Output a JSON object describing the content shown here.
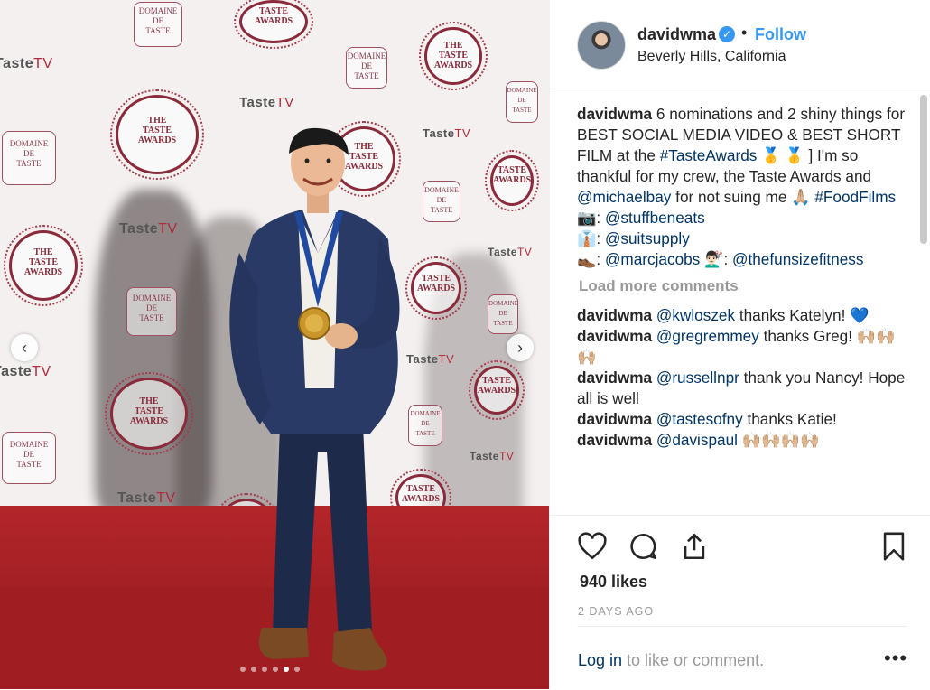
{
  "post": {
    "username": "davidwma",
    "follow_label": "Follow",
    "separator": "•",
    "location": "Beverly Hills, California",
    "verified_glyph": "✓"
  },
  "photo": {
    "backdrop_logos": {
      "domaine": [
        "DOMAINE",
        "DE",
        "TASTE"
      ],
      "taste_awards": [
        "THE",
        "TASTE",
        "AWARDS"
      ],
      "tastetv_a": "Taste",
      "tastetv_b": "TV"
    },
    "prev_glyph": "‹",
    "next_glyph": "›",
    "carousel": {
      "count": 6,
      "active_index": 4
    }
  },
  "caption": {
    "username": "davidwma",
    "text_1": " 6 nominations and 2 shiny things for BEST SOCIAL MEDIA VIDEO & BEST SHORT FILM at the ",
    "tag_taste": "#TasteAwards",
    "text_2": " 🥇 🥇 ] I'm so thankful for my crew, the Taste Awards and ",
    "mention_bay": "@michaelbay",
    "text_3": " for not suing me 🙏🏼 ",
    "tag_food": "#FoodFilms",
    "credit_1_prefix": "📷: ",
    "credit_1": "@stuffbeneats",
    "credit_2_prefix": "👔: ",
    "credit_2": "@suitsupply",
    "credit_3_prefix": "👞: ",
    "credit_3": "@marcjacobs",
    "credit_4_prefix": " 💇🏻‍♂️: ",
    "credit_4": "@thefunsizefitness"
  },
  "load_more": "Load more comments",
  "comments": [
    {
      "user": "davidwma",
      "mention": "@kwloszek",
      "text": " thanks Katelyn! 💙"
    },
    {
      "user": "davidwma",
      "mention": "@gregremmey",
      "text": " thanks Greg! 🙌🏼🙌🏼🙌🏼"
    },
    {
      "user": "davidwma",
      "mention": "@russellnpr",
      "text": " thank you Nancy! Hope all is well"
    },
    {
      "user": "davidwma",
      "mention": "@tastesofny",
      "text": " thanks Katie!"
    },
    {
      "user": "davidwma",
      "mention": "@davispaul",
      "text": " 🙌🏼🙌🏼🙌🏼🙌🏼"
    }
  ],
  "likes": "940 likes",
  "time_ago": "2 DAYS AGO",
  "footer": {
    "login": "Log in",
    "rest": " to like or comment.",
    "more": "•••"
  }
}
